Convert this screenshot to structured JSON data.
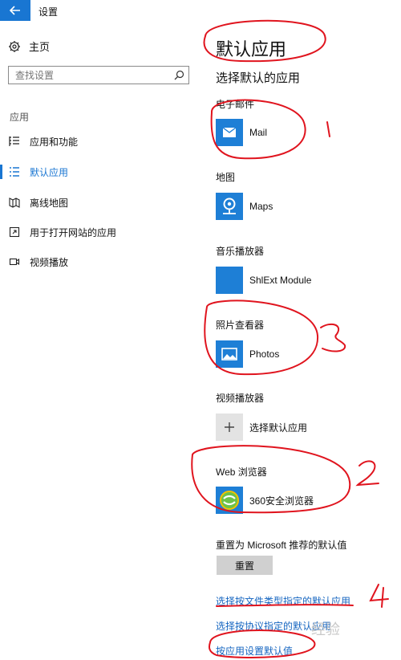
{
  "window": {
    "title": "设置"
  },
  "sidebar": {
    "home_label": "主页",
    "search_placeholder": "查找设置",
    "section_title": "应用",
    "items": [
      {
        "label": "应用和功能",
        "icon": "list-icon"
      },
      {
        "label": "默认应用",
        "icon": "default-apps-icon",
        "active": true
      },
      {
        "label": "离线地图",
        "icon": "map-icon"
      },
      {
        "label": "用于打开网站的应用",
        "icon": "open-in-icon"
      },
      {
        "label": "视频播放",
        "icon": "video-icon"
      }
    ]
  },
  "main": {
    "title": "默认应用",
    "subtitle": "选择默认的应用",
    "categories": [
      {
        "label": "电子邮件",
        "app": "Mail",
        "icon": "mail-icon"
      },
      {
        "label": "地图",
        "app": "Maps",
        "icon": "maps-icon"
      },
      {
        "label": "音乐播放器",
        "app": "ShlExt Module",
        "icon": "blank-icon"
      },
      {
        "label": "照片查看器",
        "app": "Photos",
        "icon": "photos-icon"
      },
      {
        "label": "视频播放器",
        "app": "选择默认应用",
        "icon": "plus-icon"
      },
      {
        "label": "Web 浏览器",
        "app": "360安全浏览器",
        "icon": "browser-360-icon"
      }
    ],
    "reset_label": "重置为 Microsoft 推荐的默认值",
    "reset_button": "重置",
    "links": [
      "选择按文件类型指定的默认应用",
      "选择按协议指定的默认应用",
      "按应用设置默认值"
    ]
  },
  "annotations": [
    "1",
    "2",
    "3",
    "4"
  ],
  "watermark": "经验",
  "colors": {
    "accent": "#1976d2",
    "annotation": "#e0141e",
    "tile": "#1e7fd6"
  }
}
